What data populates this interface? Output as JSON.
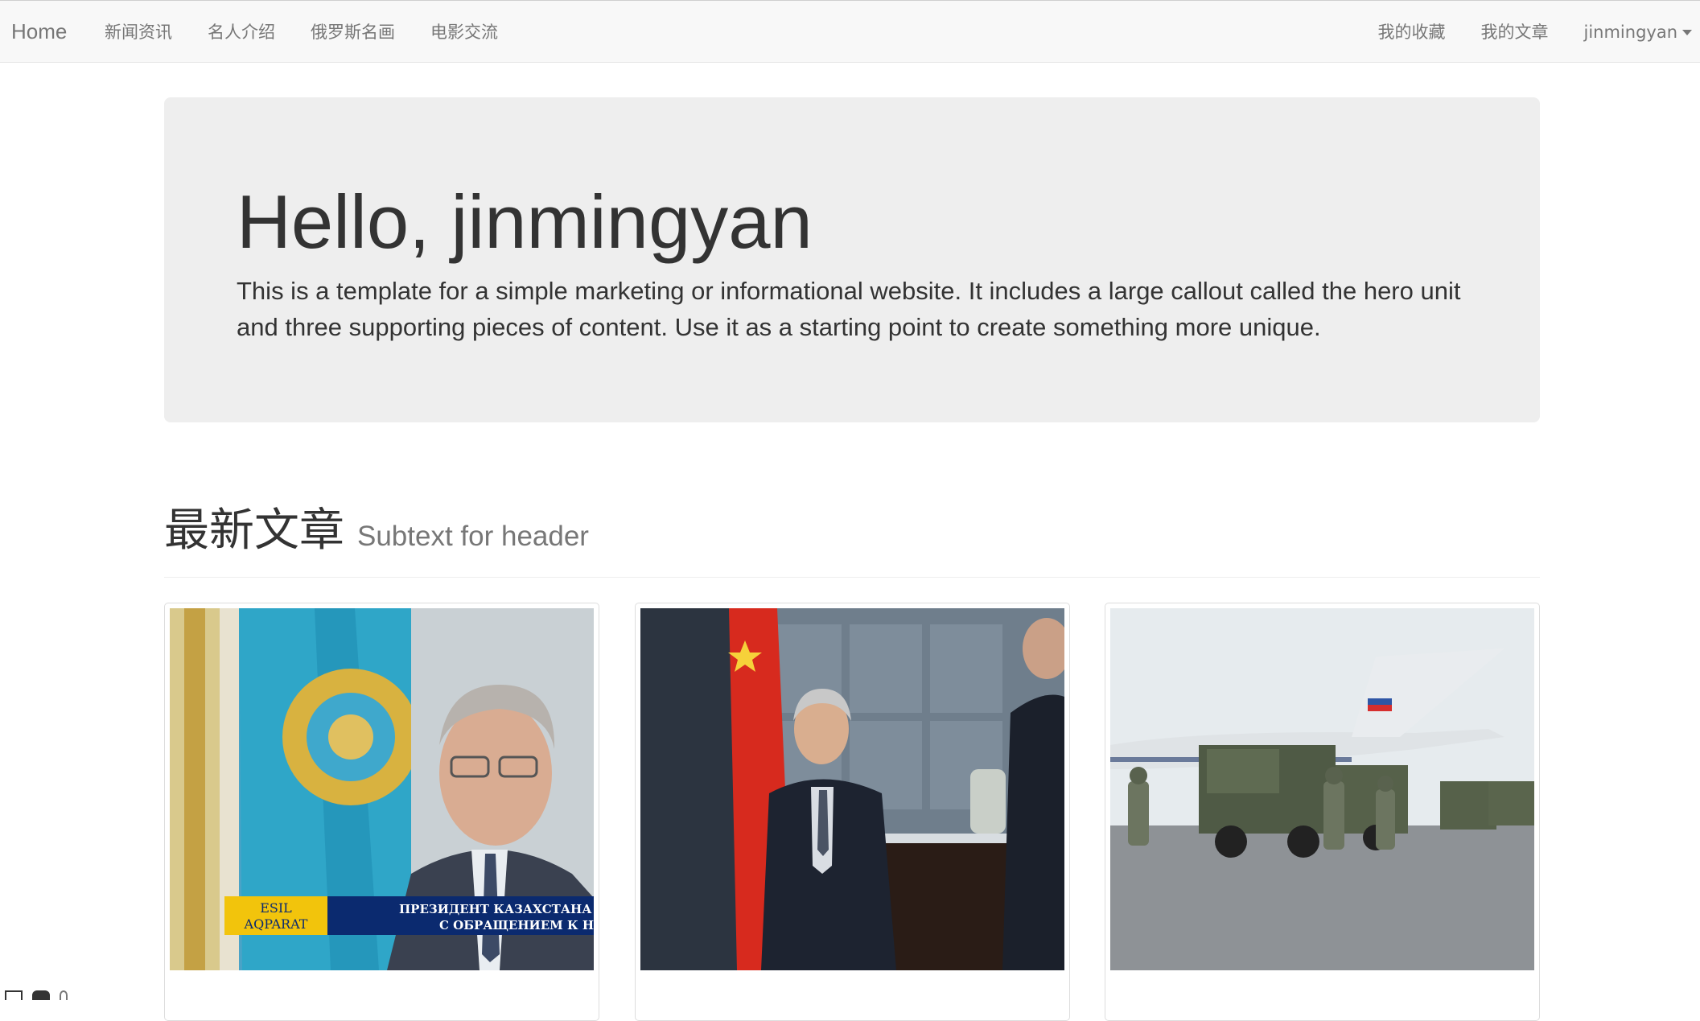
{
  "navbar": {
    "brand": "Home",
    "left_items": [
      {
        "label": "新闻资讯"
      },
      {
        "label": "名人介绍"
      },
      {
        "label": "俄罗斯名画"
      },
      {
        "label": "电影交流"
      }
    ],
    "right_items": [
      {
        "label": "我的收藏"
      },
      {
        "label": "我的文章"
      }
    ],
    "user": {
      "label": "jinmingyan",
      "icon": "chevron-down-icon"
    }
  },
  "hero": {
    "title": "Hello, jinmingyan",
    "text": "This is a template for a simple marketing or informational website. It includes a large callout called the hero unit and three supporting pieces of content. Use it as a starting point to create something more unique."
  },
  "section": {
    "title": "最新文章",
    "subtext": "Subtext for header"
  },
  "articles": [
    {
      "image": "news-photo-kazakhstan-president",
      "caption_logo_line1": "ESIL",
      "caption_logo_line2": "AQPARAT",
      "caption_line1": "ПРЕЗИДЕНТ КАЗАХСТАНА",
      "caption_line2": "С ОБРАЩЕНИЕМ К НА"
    },
    {
      "image": "news-photo-diplomat-with-flag"
    },
    {
      "image": "news-photo-military-trucks-airfield"
    }
  ],
  "colors": {
    "navbar_bg": "#f8f8f8",
    "nav_text": "#777777",
    "jumbotron_bg": "#eeeeee",
    "text": "#333333"
  }
}
